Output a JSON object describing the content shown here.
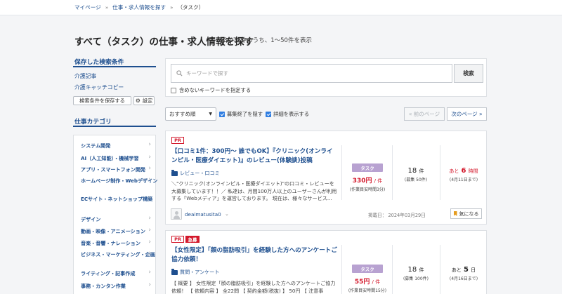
{
  "breadcrumb": {
    "items": [
      "マイページ",
      "仕事・求人情報を探す",
      "（タスク）"
    ],
    "separator": "»"
  },
  "page": {
    "title": "すべて（タスク）の仕事・求人情報を探す",
    "count": "13,073件のうち、1〜50件を表示"
  },
  "sidebar": {
    "saved_heading": "保存した検索条件",
    "saved_links": [
      "介護記事",
      "介護キャッチコピー"
    ],
    "save_button": "検索条件を保存する",
    "settings_button": "設定",
    "category_heading": "仕事カテゴリ",
    "categories": [
      "システム開発",
      "AI（人工知能）・機械学習",
      "アプリ・スマートフォン開発",
      "ホームページ制作・Webデザイン",
      "ECサイト・ネットショップ構築",
      "デザイン",
      "動画・映像・アニメーション",
      "音楽・音響・ナレーション",
      "ビジネス・マーケティング・企画",
      "ライティング・記事作成",
      "事務・カンタン作業"
    ]
  },
  "search": {
    "placeholder": "キーワードで探す",
    "button": "検索",
    "exclude_label": "含めないキーワードを指定する"
  },
  "toolbar": {
    "sort_selected": "おすすめ順",
    "hide_closed_label": "募集終了を隠す",
    "show_detail_label": "詳細を表示する",
    "prev_page": "« 前のページ",
    "next_page": "次のページ »"
  },
  "jobs": [
    {
      "badges": [
        "PR"
      ],
      "title": "【口コミ1件：300円〜 誰でもOK】『クリニック(オンラインピル・医療ダイエット)』のレビュー(体験談)投稿",
      "category": "レビュー・口コミ",
      "description": "＼\"クリニック(オンラインピル・医療ダイエット)\"の口コミ・レビューを大募集しています！！／ 私達は、月間100万人以上のユーザーさんが利用する「Webメディア」を運営しております。 現在は、様々なサービス…",
      "type_tag": "タスク",
      "price": "330円",
      "price_unit": "/ 件",
      "price_note": "(作業目安時間3分)",
      "count": "18",
      "count_unit": "件",
      "count_note": "(募集 50件)",
      "remaining_prefix": "あと",
      "remaining_value": "6",
      "remaining_unit": "時間",
      "deadline": "(4月11日まで)",
      "client": "deaimatusita0",
      "posted": "掲載日： 2024年03月29日",
      "fav_button": "気になる"
    },
    {
      "badges": [
        "PR",
        "急募"
      ],
      "title": "【女性限定】「顔の脂肪吸引」を経験した方へのアンケートご協力依頼！",
      "category": "質問・アンケート",
      "description": "【 概要 】 女性限定「顔の脂肪吸引」を経験した方へのアンケートご協力依頼！ 【 依頼内容 】 全22問 【 契約金額(税抜) 】 50円 【 注意事",
      "type_tag": "タスク",
      "price": "55円",
      "price_unit": "/ 件",
      "price_note": "(作業目安時間15分)",
      "count": "18",
      "count_unit": "件",
      "count_note": "(募集 100件)",
      "remaining_prefix": "あと",
      "remaining_value": "5",
      "remaining_unit": "日",
      "deadline": "(4月16日まで)"
    }
  ],
  "colors": {
    "link_blue": "#1e4f8f",
    "alert_red": "#d3182b",
    "task_tag": "#b8a2d1",
    "fav_icon": "#e59c1f",
    "checkbox": "#2f7de1"
  }
}
